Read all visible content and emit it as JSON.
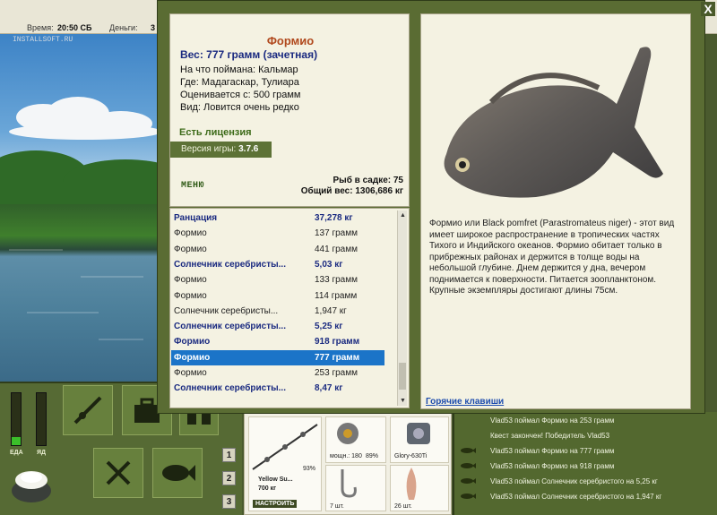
{
  "topbar": {
    "time_label": "Время:",
    "time_value": "20:50 СБ",
    "money_label": "Деньги:",
    "money_value": "3"
  },
  "watermark": "INSTALLSOFT.RU",
  "dialog": {
    "close_label": "X",
    "fish_name": "Формио",
    "weight_line": "Вес: 777 грамм (зачетная)",
    "info": [
      "На что поймана: Кальмар",
      "Где: Мадагаскар, Тулиара",
      "Оценивается с: 500 грамм",
      "Вид: Ловится очень редко"
    ],
    "license": "Есть лицензия",
    "version_label": "Версия игры: ",
    "version_value": "3.7.6",
    "menu_label": "МЕНЮ",
    "keepnet_count": "Рыб в садке: 75",
    "keepnet_weight": "Общий вес: 1306,686 кг",
    "description": "Формио или Black pomfret (Parastromateus niger) - этот вид имеет широкое распространение в тропических частях Тихого и Индийского океанов. Формио обитает только в прибрежных районах и держится в толще воды на небольшой глубине. Днем держится у дна, вечером поднимается к поверхности. Питается зоопланктоном. Крупные экземпляры достигают длины 75см.",
    "hotkeys": "Горячие клавиши"
  },
  "fishlist": [
    {
      "name": "Ранцация",
      "weight": "37,278 кг",
      "style": "bold"
    },
    {
      "name": "Формио",
      "weight": "137 грамм",
      "style": "normal"
    },
    {
      "name": "Формио",
      "weight": "441 грамм",
      "style": "normal"
    },
    {
      "name": "Солнечник серебристы...",
      "weight": "5,03 кг",
      "style": "bold"
    },
    {
      "name": "Формио",
      "weight": "133 грамм",
      "style": "normal"
    },
    {
      "name": "Формио",
      "weight": "114 грамм",
      "style": "normal"
    },
    {
      "name": "Солнечник серебристы...",
      "weight": "1,947 кг",
      "style": "normal"
    },
    {
      "name": "Солнечник серебристы...",
      "weight": "5,25 кг",
      "style": "bold"
    },
    {
      "name": "Формио",
      "weight": "918 грамм",
      "style": "bold"
    },
    {
      "name": "Формио",
      "weight": "777 грамм",
      "style": "selected"
    },
    {
      "name": "Формио",
      "weight": "253 грамм",
      "style": "normal"
    },
    {
      "name": "Солнечник серебристы...",
      "weight": "8,47 кг",
      "style": "bold"
    }
  ],
  "bottomleft": {
    "food_label": "ЕДА",
    "poison_label": "ЯД",
    "food_level": 0.15,
    "poison_level": 0.0,
    "pages": [
      "1",
      "2",
      "3"
    ]
  },
  "tackle": {
    "rod_name": "Yellow Su...",
    "rod_weight": "700 кг",
    "rod_pct": "93%",
    "setup_button": "НАСТРОИТЬ",
    "reel_label": "мощн.: 180",
    "reel_pct": "89%",
    "line_label": "Glory-630Ti",
    "hooks_count": "7 шт.",
    "bait_count": "26 шт."
  },
  "chat": [
    {
      "text": "Vlad53 поймал Формио на 253 грамм",
      "icon": false
    },
    {
      "text": "Квест закончен! Победитель Vlad53",
      "icon": false
    },
    {
      "text": "Vlad53 поймал Формио на 777 грамм",
      "icon": true
    },
    {
      "text": "Vlad53 поймал Формио на 918 грамм",
      "icon": true
    },
    {
      "text": "Vlad53 поймал Солнечник серебристого на 5,25 кг",
      "icon": true
    },
    {
      "text": "Vlad53 поймал Солнечник серебристого на 1,947 кг",
      "icon": true
    }
  ],
  "colors": {
    "accent_selected": "#1b74c8",
    "fish_name": "#b0481c",
    "bold_row": "#1a2a80",
    "panel_green": "#5a6c33"
  }
}
